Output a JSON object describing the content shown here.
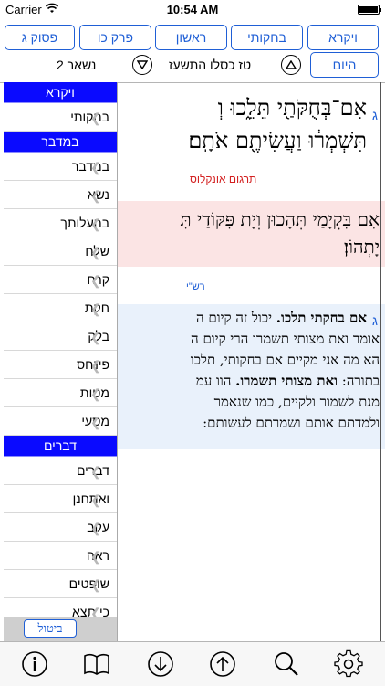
{
  "status": {
    "carrier": "Carrier",
    "time": "10:54 AM"
  },
  "top_buttons": {
    "vayikra": "ויקרא",
    "bechukotai": "בחקותי",
    "rishon": "ראשון",
    "perek": "פרק כו",
    "pasuk": "פסוק ג"
  },
  "nav": {
    "today": "היום",
    "date": "טז כסלו התשעז",
    "remaining": "נשאר 2"
  },
  "sidebar": {
    "groups": [
      {
        "header": "ויקרא",
        "items": [
          "בחקותי"
        ]
      },
      {
        "header": "במדבר",
        "items": [
          "במדבר",
          "נשא",
          "בהעלותך",
          "שלח",
          "קרח",
          "חקת",
          "בלק",
          "פינחס",
          "מטות",
          "מסעי"
        ]
      },
      {
        "header": "דברים",
        "items": [
          "דברים",
          "ואתחנן",
          "עקב",
          "ראה",
          "שופטים",
          "כי תצא"
        ]
      }
    ],
    "cancel": "ביטול"
  },
  "content": {
    "verse_number": "ג",
    "verse_line1": "אִם־בְּחֻקֹּתַ֖י תֵּלֵ֑כוּ וְ",
    "verse_line2": "תִּשְׁמְר֔וּ וַעֲשִׂיתֶ֖ם אֹתָֽם׃",
    "onkelos_label": "תרגום אונקלוס",
    "onkelos_line1": "אִם בִּקְיָמַי תְּהָכוּן וְיָת פִּקּוֹדַי תִּ",
    "onkelos_line2": "יָתְהוֹן׃",
    "rashi_label": "רש\"י",
    "rashi_number": "ג",
    "rashi_lines": [
      {
        "bold": "אם בחקתי תלכו.",
        "text": " יכול זה קיום ה"
      },
      {
        "bold": "",
        "text": "אומר ואת מצותי תשמרו הרי קיום ה"
      },
      {
        "bold": "",
        "text": "הא מה אני מקיים אם בחקותי, תלכו"
      },
      {
        "bold": "ואת מצותי תשמרו.",
        "text": "בתורה: ",
        "after": " הוו עמ",
        "bold_after": true
      },
      {
        "bold": "",
        "text": "מנת לשמור ולקיים, כמו שנאמר"
      },
      {
        "bold": "",
        "text": "ולמדתם אותם ושמרתם לעשותם:"
      }
    ]
  },
  "toolbar": {
    "icons": [
      "info-icon",
      "book-icon",
      "arrow-down-icon",
      "arrow-up-icon",
      "search-icon",
      "gear-icon"
    ]
  }
}
